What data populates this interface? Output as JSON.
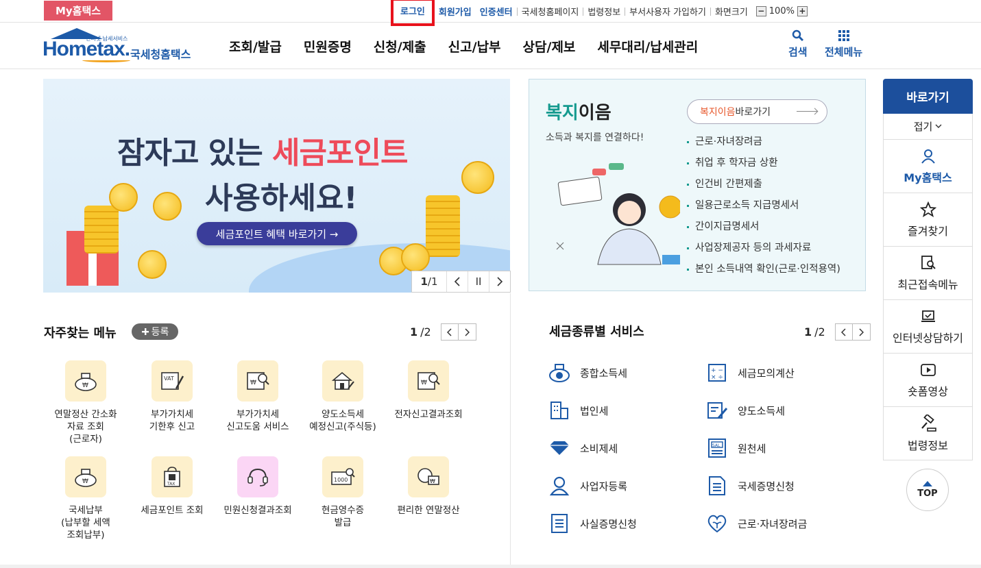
{
  "topbar": {
    "my_hometax": "My홈택스",
    "links": [
      "로그인",
      "회원가입",
      "인증센터",
      "국세청홈페이지",
      "법령정보",
      "부서사용자 가입하기",
      "화면크기"
    ],
    "zoom_minus": "−",
    "zoom_value": "100%",
    "zoom_plus": "+"
  },
  "header": {
    "logo_tag": "인터넷 납세서비스",
    "logo_text": "Hometax.",
    "logo_kr": "국세청홈택스",
    "nav": [
      "조회/발급",
      "민원증명",
      "신청/제출",
      "신고/납부",
      "상담/제보",
      "세무대리/납세관리"
    ],
    "search_label": "검색",
    "allmenu_label": "전체메뉴"
  },
  "banner": {
    "line1_prefix": "잠자고 있는 ",
    "line1_highlight": "세금포인트",
    "line2": "사용하세요!",
    "cta": "세금포인트 혜택 바로가기 →",
    "page_current": "1",
    "page_total": "/1",
    "pause": "II"
  },
  "welfare": {
    "title_green": "복지",
    "title_rest": "이음",
    "subtitle": "소득과 복지를 연결하다!",
    "btn_orange": "복지이음",
    "btn_rest": " 바로가기",
    "items": [
      "근로·자녀장려금",
      "취업 후 학자금 상환",
      "인건비 간편제출",
      "일용근로소득 지급명세서",
      "간이지급명세서",
      "사업장제공자 등의 과세자료",
      "본인 소득내역 확인(근로·인적용역)"
    ]
  },
  "quick": {
    "title": "바로가기",
    "fold": "접기",
    "items": [
      "My홈택스",
      "즐겨찾기",
      "최근접속메뉴",
      "인터넷상담하기",
      "숏폼영상",
      "법령정보"
    ],
    "top": "TOP"
  },
  "frequent": {
    "title": "자주찾는 메뉴",
    "register": "등록",
    "page_current": "1",
    "page_total": "/2",
    "items": [
      "연말정산 간소화\n자료 조회\n(근로자)",
      "부가가치세\n기한후 신고",
      "부가가치세\n신고도움 서비스",
      "양도소득세\n예정신고(주식등)",
      "전자신고결과조회",
      "국세납부\n(납부할 세액\n조회납부)",
      "세금포인트 조회",
      "민원신청결과조회",
      "현금영수증\n발급",
      "편리한 연말정산"
    ]
  },
  "taxtype": {
    "title": "세금종류별 서비스",
    "page_current": "1",
    "page_total": "/2",
    "left": [
      "종합소득세",
      "법인세",
      "소비제세",
      "사업자등록",
      "사실증명신청"
    ],
    "right": [
      "세금모의계산",
      "양도소득세",
      "원천세",
      "국세증명신청",
      "근로·자녀장려금"
    ]
  },
  "colors": {
    "brand_blue": "#1d5aa8",
    "accent_red": "#e25566",
    "highlight_red": "#e8121c",
    "welfare_green": "#159a8f"
  }
}
